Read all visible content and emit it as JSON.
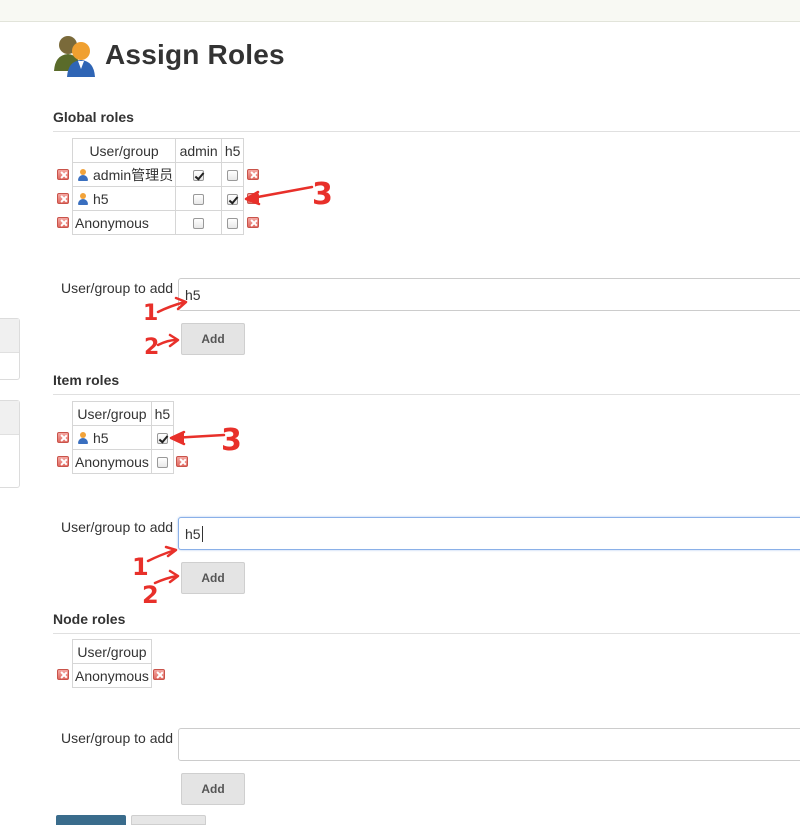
{
  "page": {
    "title": "Assign Roles"
  },
  "global_roles": {
    "heading": "Global roles",
    "columns": [
      "User/group",
      "admin",
      "h5"
    ],
    "rows": [
      {
        "name": "admin管理员",
        "is_user": true,
        "checks": [
          true,
          false
        ]
      },
      {
        "name": "h5",
        "is_user": true,
        "checks": [
          false,
          true
        ]
      },
      {
        "name": "Anonymous",
        "is_user": false,
        "checks": [
          false,
          false
        ]
      }
    ],
    "add_label": "User/group to add",
    "add_value": "h5",
    "add_button": "Add"
  },
  "item_roles": {
    "heading": "Item roles",
    "columns": [
      "User/group",
      "h5"
    ],
    "rows": [
      {
        "name": "h5",
        "is_user": true,
        "checks": [
          true
        ]
      },
      {
        "name": "Anonymous",
        "is_user": false,
        "checks": [
          false
        ]
      }
    ],
    "add_label": "User/group to add",
    "add_value": "h5",
    "add_button": "Add"
  },
  "node_roles": {
    "heading": "Node roles",
    "columns": [
      "User/group"
    ],
    "rows": [
      {
        "name": "Anonymous",
        "is_user": false,
        "checks": []
      }
    ],
    "add_label": "User/group to add",
    "add_value": "",
    "add_button": "Add"
  },
  "annotations": {
    "step1": "1",
    "step2": "2",
    "step3": "3",
    "color": "#e8302a"
  },
  "colors": {
    "primary_button": "#3a6c8c",
    "secondary_button": "#e6e6e6"
  }
}
